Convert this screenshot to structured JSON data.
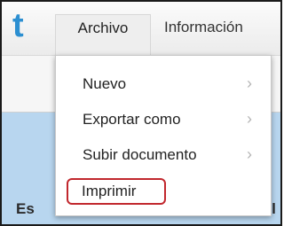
{
  "app": {
    "logo": "t"
  },
  "tabs": [
    {
      "label": "Archivo",
      "active": true
    },
    {
      "label": "Información",
      "active": false
    }
  ],
  "menu": {
    "items": [
      {
        "label": "Nuevo",
        "submenu": true
      },
      {
        "label": "Exportar como",
        "submenu": true
      },
      {
        "label": "Subir documento",
        "submenu": true
      },
      {
        "label": "Imprimir",
        "submenu": false,
        "highlighted": true
      }
    ],
    "submenu_glyph": "›"
  },
  "background": {
    "left_fragment": "Es",
    "right_fragment": "lel"
  },
  "colors": {
    "logo": "#2c8fd1",
    "highlight_border": "#c1272d",
    "content_bg": "#b8d6ef"
  }
}
